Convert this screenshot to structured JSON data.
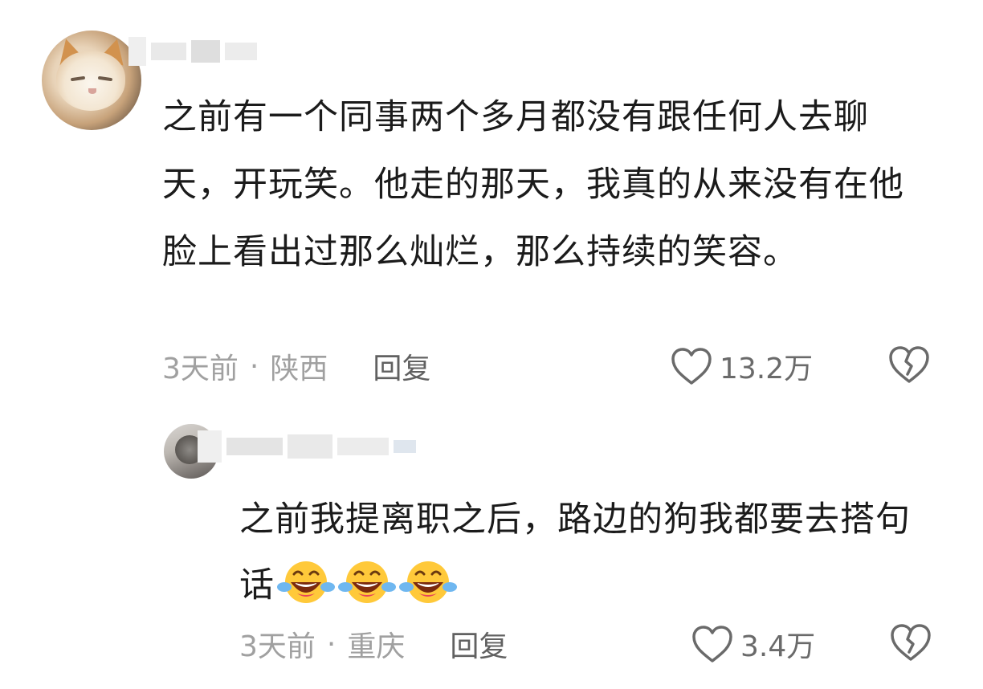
{
  "main_comment": {
    "text": "之前有一个同事两个多月都没有跟任何人去聊天，开玩笑。他走的那天，我真的从来没有在他脸上看出过那么灿烂，那么持续的笑容。",
    "time": "3天前",
    "separator": "·",
    "location": "陕西",
    "reply_label": "回复",
    "like_count": "13.2万"
  },
  "reply_comment": {
    "text": "之前我提离职之后，路边的狗我都要去搭句话",
    "time": "3天前",
    "separator": "·",
    "location": "重庆",
    "reply_label": "回复",
    "like_count": "3.4万"
  },
  "colors": {
    "text": "#1b1b1b",
    "meta": "#a0a0a0",
    "action": "#616161",
    "blur": "#e9e9e9"
  },
  "icons": {
    "like": "heart-outline-icon",
    "dislike": "broken-heart-icon",
    "emoji": "laughing-with-tears-emoji"
  }
}
